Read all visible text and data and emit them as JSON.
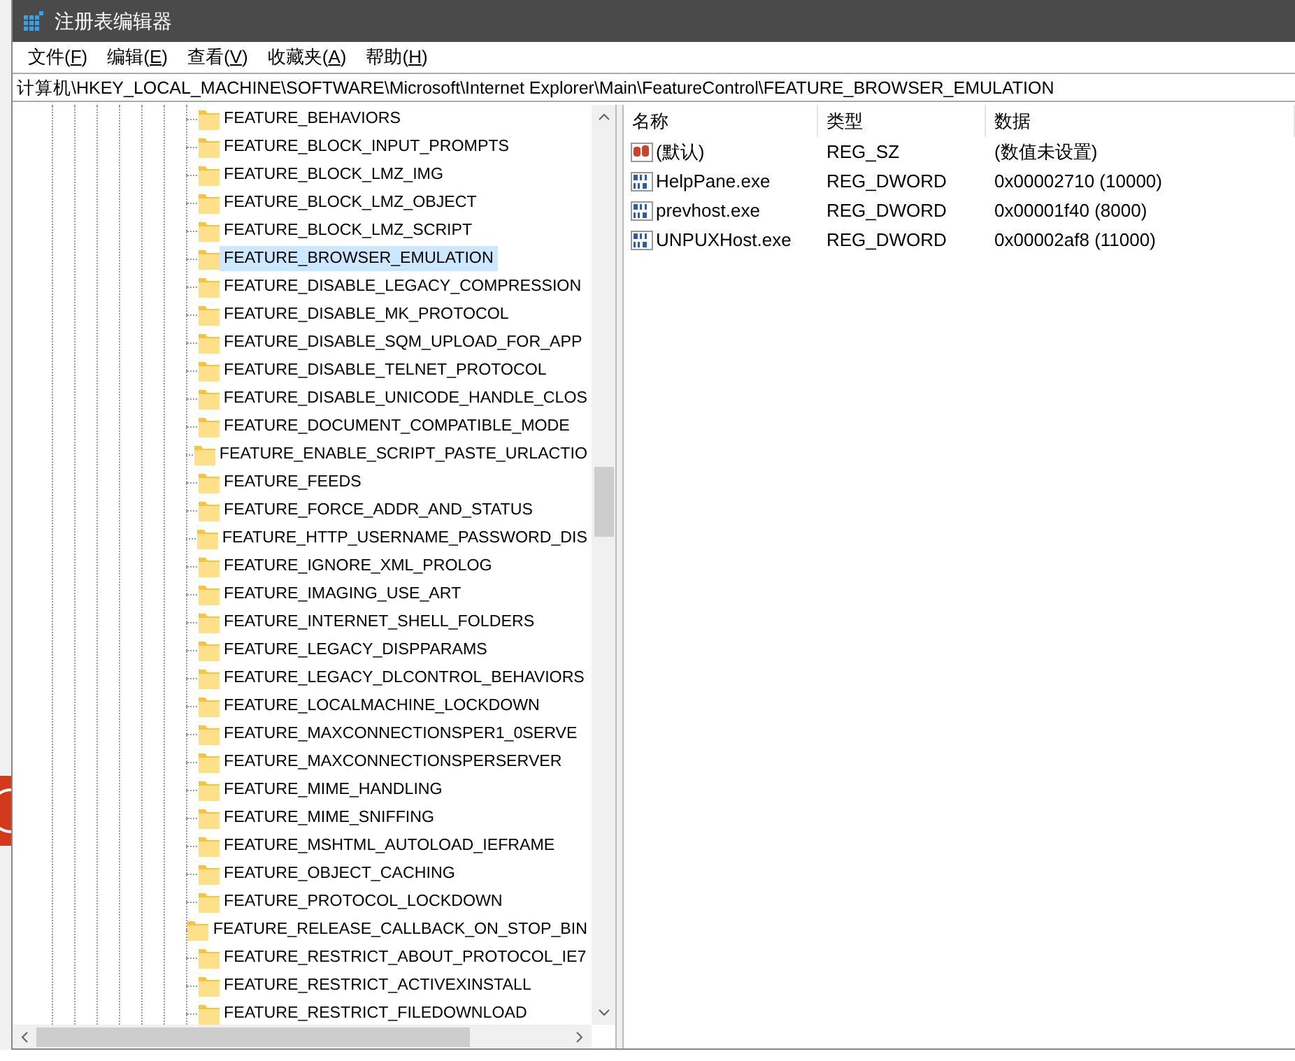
{
  "window": {
    "title": "注册表编辑器"
  },
  "menu": [
    {
      "label": "文件(F)"
    },
    {
      "label": "编辑(E)"
    },
    {
      "label": "查看(V)"
    },
    {
      "label": "收藏夹(A)"
    },
    {
      "label": "帮助(H)"
    }
  ],
  "address": "计算机\\HKEY_LOCAL_MACHINE\\SOFTWARE\\Microsoft\\Internet Explorer\\Main\\FeatureControl\\FEATURE_BROWSER_EMULATION",
  "tree": {
    "items": [
      {
        "label": "FEATURE_BEHAVIORS",
        "selected": false
      },
      {
        "label": "FEATURE_BLOCK_INPUT_PROMPTS",
        "selected": false
      },
      {
        "label": "FEATURE_BLOCK_LMZ_IMG",
        "selected": false
      },
      {
        "label": "FEATURE_BLOCK_LMZ_OBJECT",
        "selected": false
      },
      {
        "label": "FEATURE_BLOCK_LMZ_SCRIPT",
        "selected": false
      },
      {
        "label": "FEATURE_BROWSER_EMULATION",
        "selected": true
      },
      {
        "label": "FEATURE_DISABLE_LEGACY_COMPRESSION",
        "selected": false
      },
      {
        "label": "FEATURE_DISABLE_MK_PROTOCOL",
        "selected": false
      },
      {
        "label": "FEATURE_DISABLE_SQM_UPLOAD_FOR_APP",
        "selected": false
      },
      {
        "label": "FEATURE_DISABLE_TELNET_PROTOCOL",
        "selected": false
      },
      {
        "label": "FEATURE_DISABLE_UNICODE_HANDLE_CLOS",
        "selected": false
      },
      {
        "label": "FEATURE_DOCUMENT_COMPATIBLE_MODE",
        "selected": false
      },
      {
        "label": "FEATURE_ENABLE_SCRIPT_PASTE_URLACTIO",
        "selected": false
      },
      {
        "label": "FEATURE_FEEDS",
        "selected": false
      },
      {
        "label": "FEATURE_FORCE_ADDR_AND_STATUS",
        "selected": false
      },
      {
        "label": "FEATURE_HTTP_USERNAME_PASSWORD_DIS",
        "selected": false
      },
      {
        "label": "FEATURE_IGNORE_XML_PROLOG",
        "selected": false
      },
      {
        "label": "FEATURE_IMAGING_USE_ART",
        "selected": false
      },
      {
        "label": "FEATURE_INTERNET_SHELL_FOLDERS",
        "selected": false
      },
      {
        "label": "FEATURE_LEGACY_DISPPARAMS",
        "selected": false
      },
      {
        "label": "FEATURE_LEGACY_DLCONTROL_BEHAVIORS",
        "selected": false
      },
      {
        "label": "FEATURE_LOCALMACHINE_LOCKDOWN",
        "selected": false
      },
      {
        "label": "FEATURE_MAXCONNECTIONSPER1_0SERVE",
        "selected": false
      },
      {
        "label": "FEATURE_MAXCONNECTIONSPERSERVER",
        "selected": false
      },
      {
        "label": "FEATURE_MIME_HANDLING",
        "selected": false
      },
      {
        "label": "FEATURE_MIME_SNIFFING",
        "selected": false
      },
      {
        "label": "FEATURE_MSHTML_AUTOLOAD_IEFRAME",
        "selected": false
      },
      {
        "label": "FEATURE_OBJECT_CACHING",
        "selected": false
      },
      {
        "label": "FEATURE_PROTOCOL_LOCKDOWN",
        "selected": false
      },
      {
        "label": "FEATURE_RELEASE_CALLBACK_ON_STOP_BIN",
        "selected": false
      },
      {
        "label": "FEATURE_RESTRICT_ABOUT_PROTOCOL_IE7",
        "selected": false
      },
      {
        "label": "FEATURE_RESTRICT_ACTIVEXINSTALL",
        "selected": false
      },
      {
        "label": "FEATURE_RESTRICT_FILEDOWNLOAD",
        "selected": false
      }
    ]
  },
  "values": {
    "columns": [
      "名称",
      "类型",
      "数据"
    ],
    "rows": [
      {
        "kind": "string",
        "name": "(默认)",
        "type": "REG_SZ",
        "data": "(数值未设置)"
      },
      {
        "kind": "dword",
        "name": "HelpPane.exe",
        "type": "REG_DWORD",
        "data": "0x00002710 (10000)"
      },
      {
        "kind": "dword",
        "name": "prevhost.exe",
        "type": "REG_DWORD",
        "data": "0x00001f40 (8000)"
      },
      {
        "kind": "dword",
        "name": "UNPUXHost.exe",
        "type": "REG_DWORD",
        "data": "0x00002af8 (11000)"
      }
    ]
  }
}
